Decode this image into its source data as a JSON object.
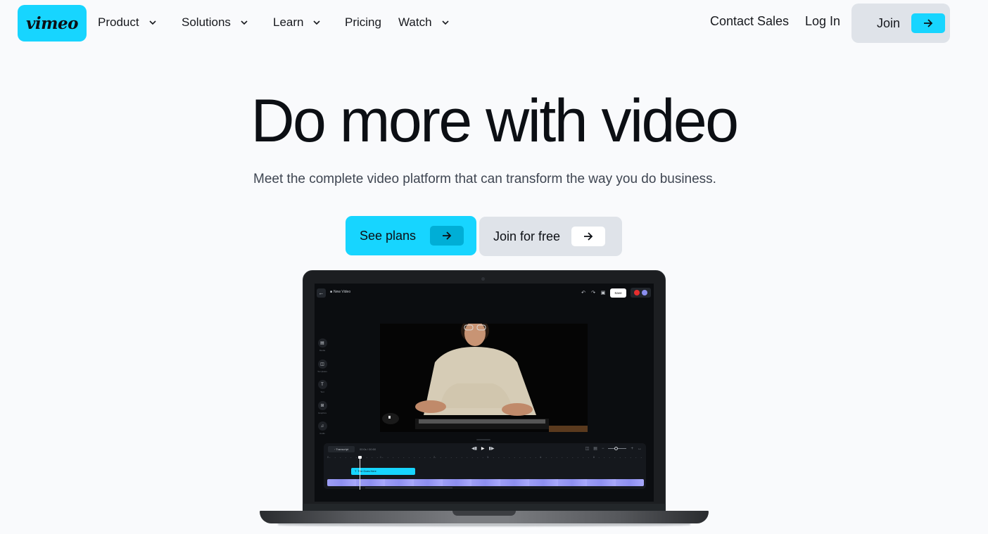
{
  "nav": {
    "logo": "vimeo",
    "items": [
      {
        "label": "Product",
        "has_dropdown": true
      },
      {
        "label": "Solutions",
        "has_dropdown": true
      },
      {
        "label": "Learn",
        "has_dropdown": true
      },
      {
        "label": "Pricing",
        "has_dropdown": false
      },
      {
        "label": "Watch",
        "has_dropdown": true
      }
    ],
    "contact_sales": "Contact Sales",
    "log_in": "Log In",
    "join": "Join"
  },
  "hero": {
    "title": "Do more with video",
    "subtitle": "Meet the complete video platform that can transform the way you do business.",
    "cta_primary": "See plans",
    "cta_secondary": "Join for free"
  },
  "editor": {
    "project_title": "New Video",
    "save_label": "Save",
    "sidebar": [
      {
        "label": "Media",
        "icon": "media-icon"
      },
      {
        "label": "Templates",
        "icon": "templates-icon"
      },
      {
        "label": "Text",
        "icon": "text-icon"
      },
      {
        "label": "Graphics",
        "icon": "graphics-icon"
      },
      {
        "label": "Audio",
        "icon": "audio-icon"
      }
    ],
    "timeline": {
      "transcript_label": "Transcript",
      "time": "00:0s / 00:50",
      "ruler": [
        "0",
        "1",
        "2",
        "3",
        "4",
        "5"
      ],
      "title_clip": "Title Goes Here"
    }
  },
  "colors": {
    "brand": "#17d5ff",
    "brand_dark": "#00aed6",
    "secondary_button": "#dfe3e9",
    "background": "#f9fafc",
    "text": "#0c0f14",
    "video_track": "#9d9ef5"
  }
}
